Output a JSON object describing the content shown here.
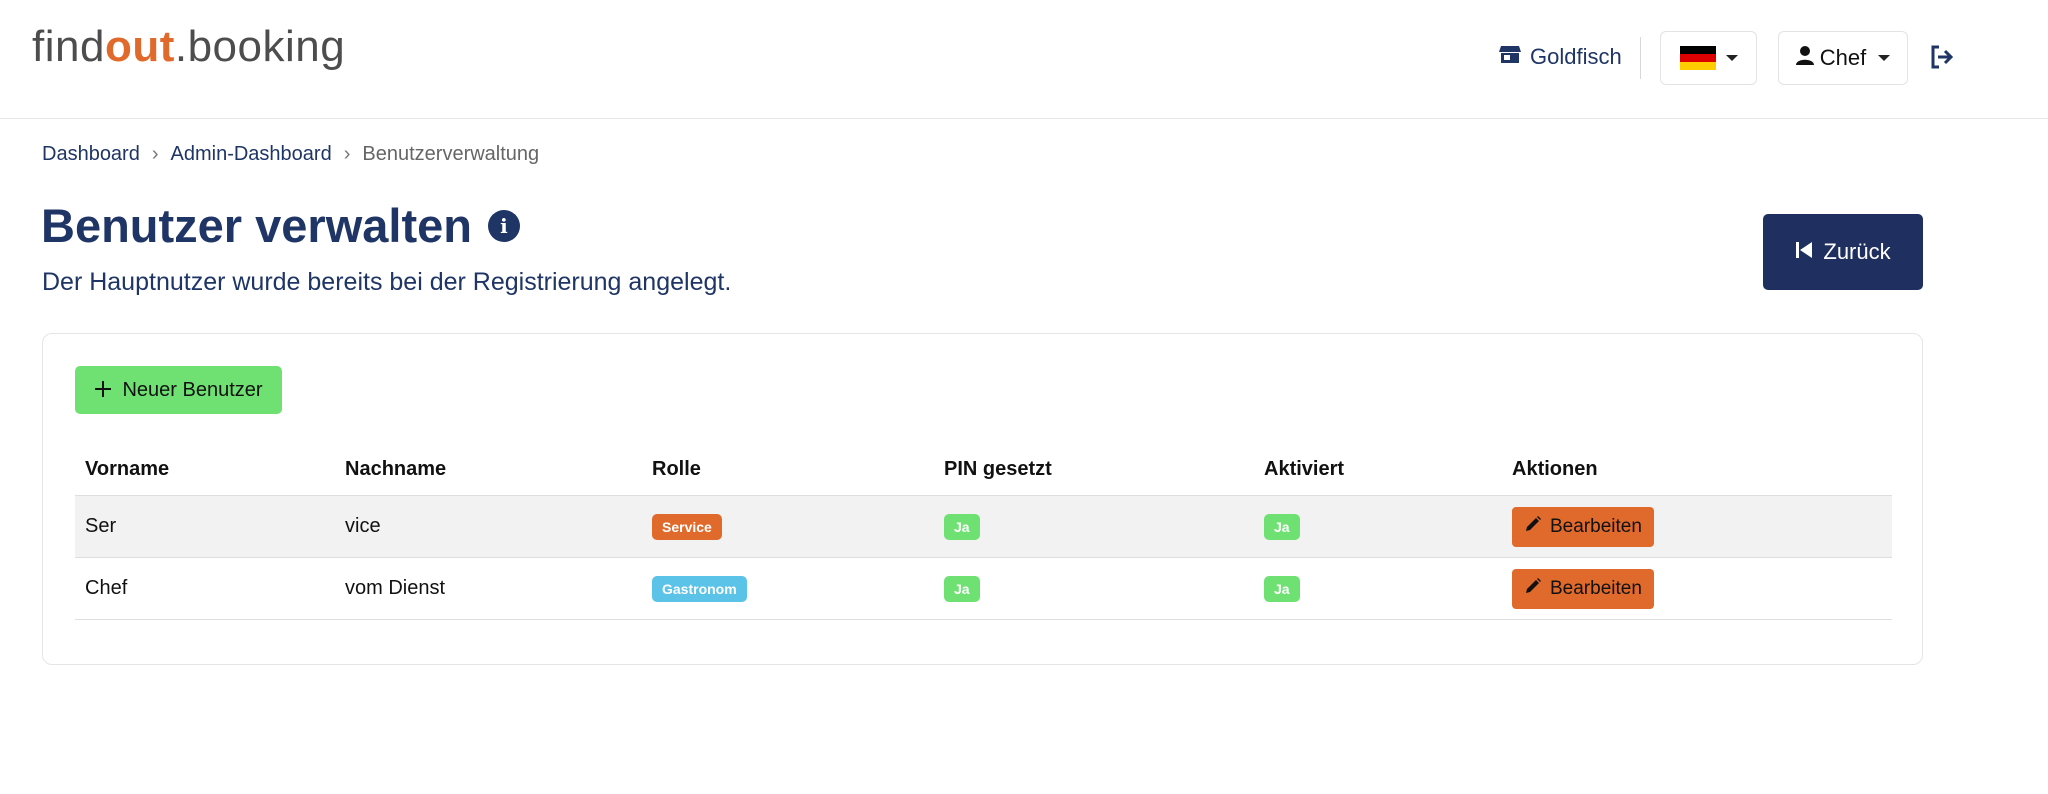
{
  "header": {
    "logo": {
      "part1": "find",
      "part2": "out",
      "part3": ".booking"
    },
    "store_name": "Goldfisch",
    "store_icon": "store-icon",
    "language_flag": "flag-de",
    "flag_colors": [
      "#000000",
      "#dd0000",
      "#ffcc00"
    ],
    "user_name": "Chef",
    "logout_icon": "logout-icon"
  },
  "breadcrumb": {
    "items": [
      "Dashboard",
      "Admin-Dashboard"
    ],
    "separator": "›",
    "current": "Benutzerverwaltung"
  },
  "page": {
    "title": "Benutzer verwalten",
    "info_glyph": "i",
    "subtitle": "Der Hauptnutzer wurde bereits bei der Registrierung angelegt.",
    "back_label": "Zurück"
  },
  "card": {
    "new_user_label": "Neuer Benutzer",
    "columns": [
      "Vorname",
      "Nachname",
      "Rolle",
      "PIN gesetzt",
      "Aktiviert",
      "Aktionen"
    ],
    "rows": [
      {
        "first": "Ser",
        "last": "vice",
        "role": "Service",
        "pin": "Ja",
        "active": "Ja",
        "action": "Bearbeiten"
      },
      {
        "first": "Chef",
        "last": "vom Dienst",
        "role": "Gastronom",
        "pin": "Ja",
        "active": "Ja",
        "action": "Bearbeiten"
      }
    ]
  },
  "colors": {
    "brand_navy": "#1f3566",
    "brand_orange": "#e06a2b",
    "success_green": "#6ee172",
    "info_cyan": "#5bc3e8"
  }
}
